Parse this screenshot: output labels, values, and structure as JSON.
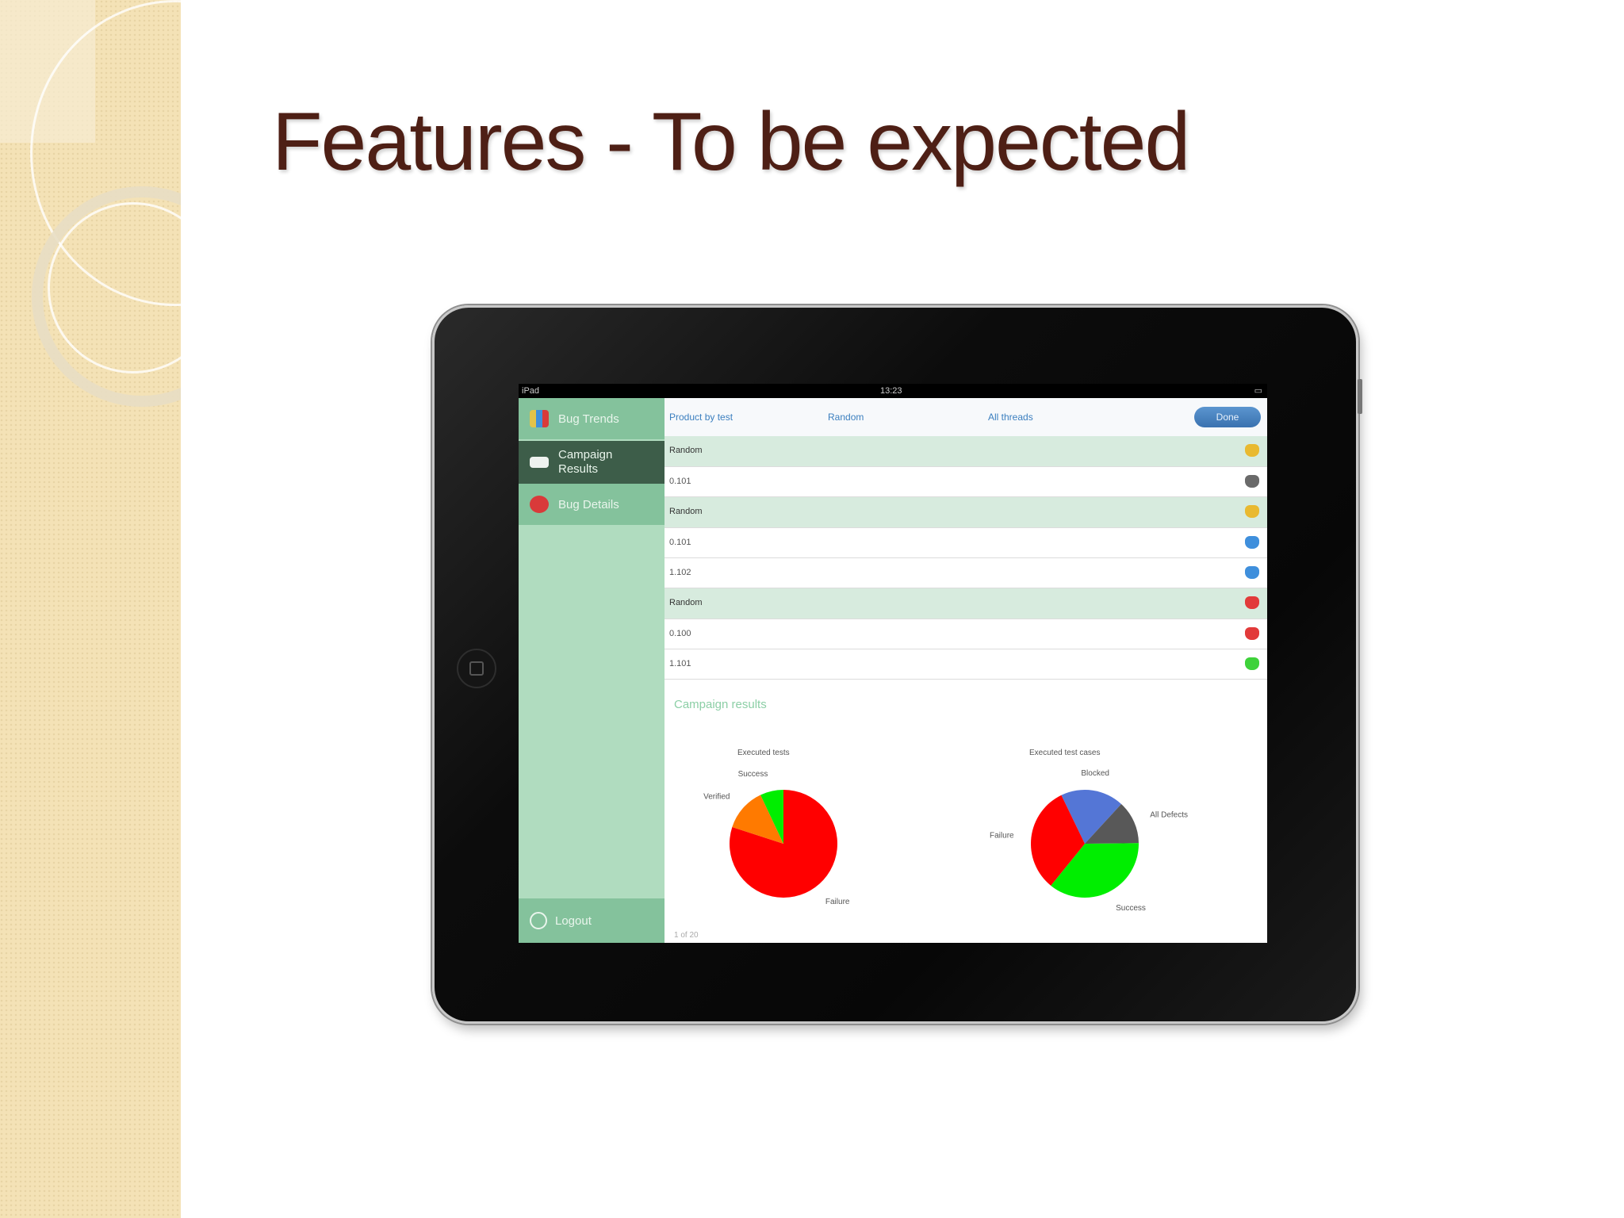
{
  "slide": {
    "title": "Features - To be expected"
  },
  "status_bar": {
    "left": "iPad",
    "center": "13:23",
    "right": ""
  },
  "sidebar": {
    "items": [
      {
        "label": "Bug Trends",
        "active": false,
        "icon": "bug-trends-icon",
        "icon_color": "#e2c34a"
      },
      {
        "label": "Campaign Results",
        "active": true,
        "icon": "campaign-results-icon",
        "icon_color": "#eef2ef"
      },
      {
        "label": "Bug Details",
        "active": false,
        "icon": "bug-details-icon",
        "icon_color": "#d93a3a"
      }
    ],
    "logout_label": "Logout"
  },
  "toolbar": {
    "tab_1": "Product by test",
    "tab_2": "Random",
    "tab_3": "All threads",
    "done_label": "Done"
  },
  "table": {
    "rows": [
      {
        "kind": "group",
        "text": "Random",
        "status_color": "#e9b930"
      },
      {
        "kind": "item",
        "text": "0.101",
        "status_color": "#6a6a6a"
      },
      {
        "kind": "group",
        "text": "Random",
        "status_color": "#e9b930"
      },
      {
        "kind": "item",
        "text": "0.101",
        "status_color": "#3f8fdc"
      },
      {
        "kind": "item",
        "text": "1.102",
        "status_color": "#3f8fdc"
      },
      {
        "kind": "group",
        "text": "Random",
        "status_color": "#e23a3a"
      },
      {
        "kind": "item",
        "text": "0.100",
        "status_color": "#e23a3a"
      },
      {
        "kind": "item",
        "text": "1.101",
        "status_color": "#3ed23a"
      }
    ]
  },
  "campaign": {
    "section_title": "Campaign results",
    "footer_note": "1 of 20"
  },
  "chart_data": [
    {
      "type": "pie",
      "title": "Executed tests",
      "slices": [
        {
          "label": "Failure",
          "value": 80,
          "color": "#ff0000"
        },
        {
          "label": "Verified",
          "value": 13,
          "color": "#ff7a00"
        },
        {
          "label": "Success",
          "value": 7,
          "color": "#00ee00"
        }
      ]
    },
    {
      "type": "pie",
      "title": "Executed test cases",
      "slices": [
        {
          "label": "Blocked",
          "value": 19,
          "color": "#5476d6"
        },
        {
          "label": "All Defects",
          "value": 13,
          "color": "#585858"
        },
        {
          "label": "Success",
          "value": 36,
          "color": "#00ee00"
        },
        {
          "label": "Failure",
          "value": 32,
          "color": "#ff0000"
        }
      ]
    }
  ]
}
